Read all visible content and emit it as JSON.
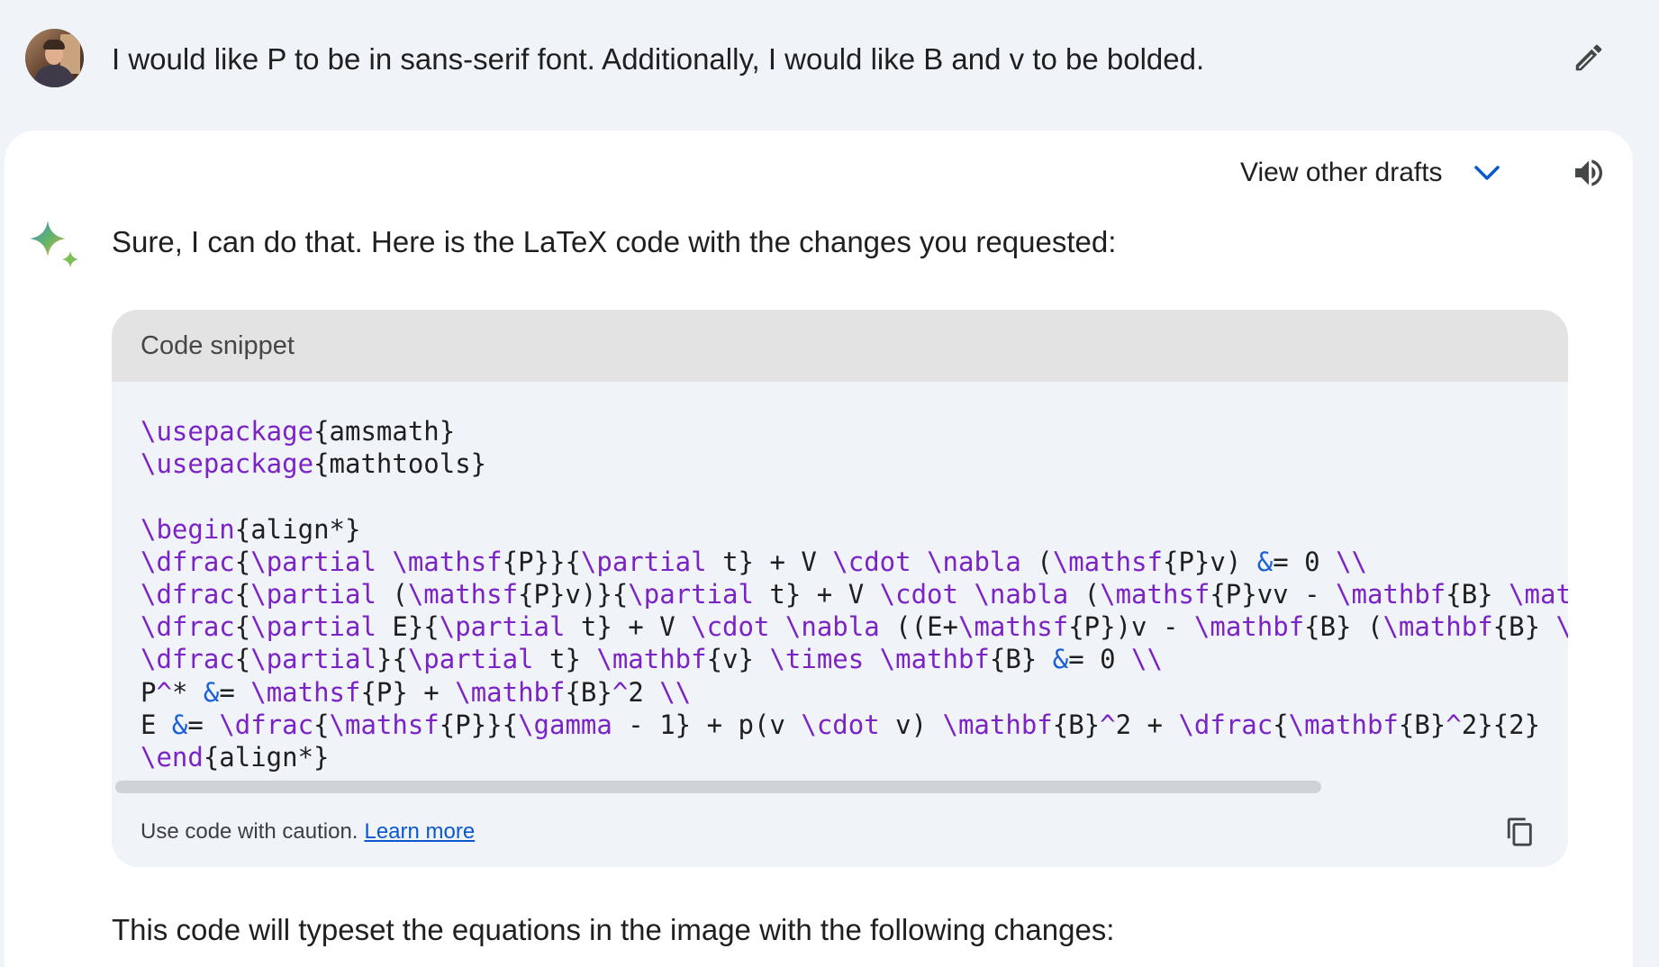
{
  "prompt": {
    "text": "I would like P to be in sans-serif font. Additionally, I would like B and v to be bolded."
  },
  "icons": {
    "avatar": "user-avatar",
    "edit": "pencil-icon",
    "drafts_chevron": "chevron-down-icon",
    "speaker": "speaker-icon",
    "sparkle": "gemini-sparkle-icon",
    "copy": "copy-icon"
  },
  "response": {
    "drafts_label": "View other drafts",
    "intro": "Sure, I can do that. Here is the LaTeX code with the changes you requested:",
    "code_title": "Code snippet",
    "code_lines": [
      [
        [
          "kw",
          "\\usepackage"
        ],
        [
          "t",
          "{amsmath}"
        ]
      ],
      [
        [
          "kw",
          "\\usepackage"
        ],
        [
          "t",
          "{mathtools}"
        ]
      ],
      [],
      [
        [
          "kw",
          "\\begin"
        ],
        [
          "t",
          "{align*}"
        ]
      ],
      [
        [
          "kw",
          "\\dfrac"
        ],
        [
          "t",
          "{"
        ],
        [
          "kw",
          "\\partial"
        ],
        [
          "t",
          " "
        ],
        [
          "kw",
          "\\mathsf"
        ],
        [
          "t",
          "{P}}{"
        ],
        [
          "kw",
          "\\partial"
        ],
        [
          "t",
          " t} + V "
        ],
        [
          "kw",
          "\\cdot"
        ],
        [
          "t",
          " "
        ],
        [
          "kw",
          "\\nabla"
        ],
        [
          "t",
          " ("
        ],
        [
          "kw",
          "\\mathsf"
        ],
        [
          "t",
          "{P}v) "
        ],
        [
          "op",
          "&"
        ],
        [
          "t",
          "= 0 "
        ],
        [
          "kw",
          "\\\\"
        ]
      ],
      [
        [
          "kw",
          "\\dfrac"
        ],
        [
          "t",
          "{"
        ],
        [
          "kw",
          "\\partial"
        ],
        [
          "t",
          " ("
        ],
        [
          "kw",
          "\\mathsf"
        ],
        [
          "t",
          "{P}v)}{"
        ],
        [
          "kw",
          "\\partial"
        ],
        [
          "t",
          " t} + V "
        ],
        [
          "kw",
          "\\cdot"
        ],
        [
          "t",
          " "
        ],
        [
          "kw",
          "\\nabla"
        ],
        [
          "t",
          " ("
        ],
        [
          "kw",
          "\\mathsf"
        ],
        [
          "t",
          "{P}vv - "
        ],
        [
          "kw",
          "\\mathbf"
        ],
        [
          "t",
          "{B} "
        ],
        [
          "kw",
          "\\mathbf"
        ],
        [
          "t",
          "{"
        ]
      ],
      [
        [
          "kw",
          "\\dfrac"
        ],
        [
          "t",
          "{"
        ],
        [
          "kw",
          "\\partial"
        ],
        [
          "t",
          " E}{"
        ],
        [
          "kw",
          "\\partial"
        ],
        [
          "t",
          " t} + V "
        ],
        [
          "kw",
          "\\cdot"
        ],
        [
          "t",
          " "
        ],
        [
          "kw",
          "\\nabla"
        ],
        [
          "t",
          " ((E+"
        ],
        [
          "kw",
          "\\mathsf"
        ],
        [
          "t",
          "{P})v - "
        ],
        [
          "kw",
          "\\mathbf"
        ],
        [
          "t",
          "{B} ("
        ],
        [
          "kw",
          "\\mathbf"
        ],
        [
          "t",
          "{B} "
        ],
        [
          "kw",
          "\\cdot"
        ]
      ],
      [
        [
          "kw",
          "\\dfrac"
        ],
        [
          "t",
          "{"
        ],
        [
          "kw",
          "\\partial"
        ],
        [
          "t",
          "}{"
        ],
        [
          "kw",
          "\\partial"
        ],
        [
          "t",
          " t} "
        ],
        [
          "kw",
          "\\mathbf"
        ],
        [
          "t",
          "{v} "
        ],
        [
          "kw",
          "\\times"
        ],
        [
          "t",
          " "
        ],
        [
          "kw",
          "\\mathbf"
        ],
        [
          "t",
          "{B} "
        ],
        [
          "op",
          "&"
        ],
        [
          "t",
          "= 0 "
        ],
        [
          "kw",
          "\\\\"
        ]
      ],
      [
        [
          "t",
          "P"
        ],
        [
          "kw",
          "^"
        ],
        [
          "t",
          "* "
        ],
        [
          "op",
          "&"
        ],
        [
          "t",
          "= "
        ],
        [
          "kw",
          "\\mathsf"
        ],
        [
          "t",
          "{P} + "
        ],
        [
          "kw",
          "\\mathbf"
        ],
        [
          "t",
          "{B}"
        ],
        [
          "kw",
          "^"
        ],
        [
          "t",
          "2 "
        ],
        [
          "kw",
          "\\\\"
        ]
      ],
      [
        [
          "t",
          "E "
        ],
        [
          "op",
          "&"
        ],
        [
          "t",
          "= "
        ],
        [
          "kw",
          "\\dfrac"
        ],
        [
          "t",
          "{"
        ],
        [
          "kw",
          "\\mathsf"
        ],
        [
          "t",
          "{P}}{"
        ],
        [
          "kw",
          "\\gamma"
        ],
        [
          "t",
          " - 1} + p(v "
        ],
        [
          "kw",
          "\\cdot"
        ],
        [
          "t",
          " v) "
        ],
        [
          "kw",
          "\\mathbf"
        ],
        [
          "t",
          "{B}"
        ],
        [
          "kw",
          "^"
        ],
        [
          "t",
          "2 + "
        ],
        [
          "kw",
          "\\dfrac"
        ],
        [
          "t",
          "{"
        ],
        [
          "kw",
          "\\mathbf"
        ],
        [
          "t",
          "{B}"
        ],
        [
          "kw",
          "^"
        ],
        [
          "t",
          "2}{2}"
        ]
      ],
      [
        [
          "kw",
          "\\end"
        ],
        [
          "t",
          "{align*}"
        ]
      ]
    ],
    "caution_text": "Use code with caution.",
    "learn_more": "Learn more",
    "follow_up": "This code will typeset the equations in the image with the following changes:"
  },
  "colors": {
    "page_bg": "#f0f4f9",
    "card_bg": "#ffffff",
    "code_header_bg": "#e3e3e3",
    "keyword": "#7b23c5",
    "operator": "#1a5fd6",
    "link": "#0b57d0",
    "accent_chevron": "#0b57d0"
  }
}
